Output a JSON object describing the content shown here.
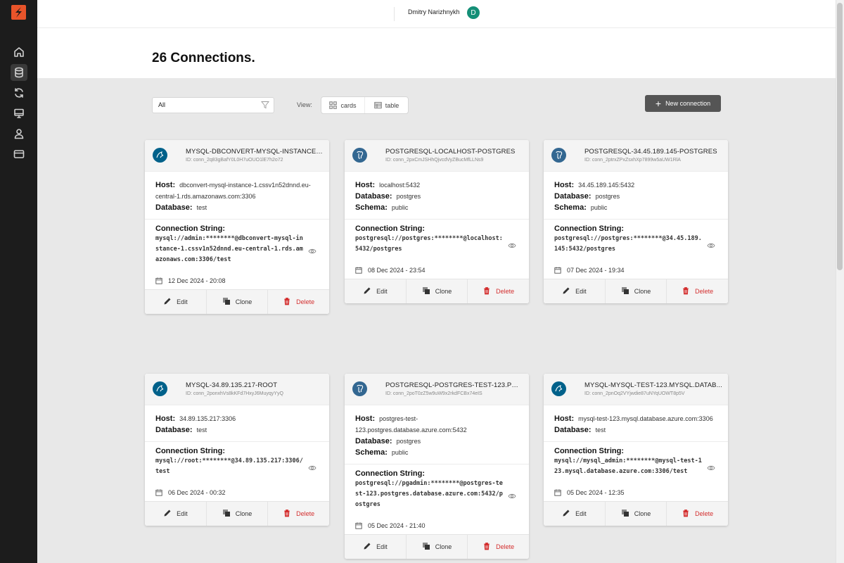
{
  "user": {
    "name": "Dmitry Narizhnykh",
    "initial": "D"
  },
  "page": {
    "title": "26 Connections."
  },
  "toolbar": {
    "filter_value": "All",
    "view_label": "View:",
    "view_cards": "cards",
    "view_table": "table",
    "new_connection": "New connection"
  },
  "labels": {
    "host": "Host:",
    "database": "Database:",
    "schema": "Schema:",
    "connection_string": "Connection String:",
    "edit": "Edit",
    "clone": "Clone",
    "delete": "Delete"
  },
  "colors": {
    "accent": "#148f77",
    "danger": "#d32f2f",
    "brand": "#e8542a",
    "mysql": "#00618a",
    "postgres": "#336791"
  },
  "cards": [
    {
      "type": "mysql",
      "name": "MYSQL-DBCONVERT-MYSQL-INSTANCE-...",
      "id": "ID: conn_2q83gBafY0L0H7uOUO1lE7h2o72",
      "host": "dbconvert-mysql-instance-1.cssv1n52dnnd.eu-central-1.rds.amazonaws.com:3306",
      "database": "test",
      "conn": "mysql://admin:********@dbconvert-mysql-instance-1.cssv1n52dnnd.eu-central-1.rds.amazonaws.com:3306/test",
      "date": "12 Dec 2024 - 20:08"
    },
    {
      "type": "pg",
      "name": "POSTGRESQL-LOCALHOST-POSTGRES",
      "id": "ID: conn_2pxCmJSHhQjvcdVyZBucMfLLNs9",
      "host": "localhost:5432",
      "database": "postgres",
      "schema": "public",
      "conn": "postgresql://postgres:********@localhost:5432/postgres",
      "date": "08 Dec 2024 - 23:54"
    },
    {
      "type": "pg",
      "name": "POSTGRESQL-34.45.189.145-POSTGRES",
      "id": "ID: conn_2ptrxZPxZsxhXp7899w5aUW1RlA",
      "host": "34.45.189.145:5432",
      "database": "postgres",
      "schema": "public",
      "conn": "postgresql://postgres:********@34.45.189.145:5432/postgres",
      "date": "07 Dec 2024 - 19:34"
    },
    {
      "type": "mysql",
      "name": "MYSQL-34.89.135.217-ROOT",
      "id": "ID: conn_2ponxhVs8kKFd7HxyJ6MuyqyYyQ",
      "host": "34.89.135.217:3306",
      "database": "test",
      "conn": "mysql://root:********@34.89.135.217:3306/test",
      "date": "06 Dec 2024 - 00:32"
    },
    {
      "type": "pg",
      "name": "POSTGRESQL-POSTGRES-TEST-123.POST...",
      "id": "ID: conn_2poT0zZ5w9uW9x2rkdFCBx74eIS",
      "host": "postgres-test-123.postgres.database.azure.com:5432",
      "database": "postgres",
      "schema": "public",
      "conn": "postgresql://pgadmin:********@postgres-test-123.postgres.database.azure.com:5432/postgres",
      "date": "05 Dec 2024 - 21:40"
    },
    {
      "type": "mysql",
      "name": "MYSQL-MYSQL-TEST-123.MYSQL.DATAB...",
      "id": "ID: conn_2pnOq2VYjwdie87uNYqUOWT8p5V",
      "host": "mysql-test-123.mysql.database.azure.com:3306",
      "database": "test",
      "conn": "mysql://mysql_admin:********@mysql-test-123.mysql.database.azure.com:3306/test",
      "date": "05 Dec 2024 - 12:35"
    }
  ]
}
